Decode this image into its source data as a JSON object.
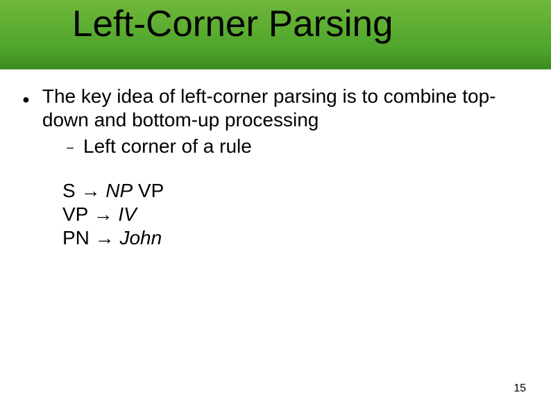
{
  "title": "Left-Corner Parsing",
  "bullet": "The key idea of left-corner parsing is to combine top-down and bottom-up processing",
  "sub": "Left corner of a rule",
  "rules": {
    "r1_lhs": "S → ",
    "r1_np": "NP",
    "r1_vp": " VP",
    "r2_lhs": "VP → ",
    "r2_iv": "IV",
    "r3_lhs": "PN → ",
    "r3_john": "John"
  },
  "page": "15"
}
